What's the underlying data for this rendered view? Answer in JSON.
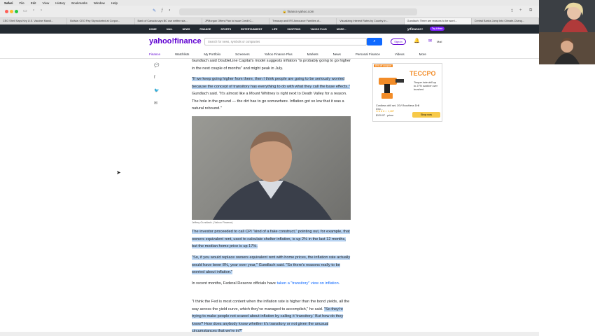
{
  "menubar": {
    "items": [
      "Safari",
      "File",
      "Edit",
      "View",
      "History",
      "Bookmarks",
      "Window",
      "Help"
    ]
  },
  "browser": {
    "url": "finance.yahoo.com",
    "tabs": [
      "CEO Shell Says Key U.S. Vaccine Mandl...",
      "Bolivia: CEO Pay Skyrocketed at Corpor...",
      "Bank of Canada says BC use written sta...",
      "JPMorgan Offers Plan to issue Credit C...",
      "Treasury and IRS Announce Families of...",
      "Visualizing Interest Rates by Country in...",
      "Gundlach: There are reasons to be worri...",
      "Central Banks Jump Into Climate-Chang..."
    ]
  },
  "ynav": {
    "items": [
      "HOME",
      "MAIL",
      "NEWS",
      "FINANCE",
      "SPORTS",
      "ENTERTAINMENT",
      "LIFE",
      "SHOPPING",
      "YAHOO PLUS",
      "MORE..."
    ],
    "brand": "y!finance+",
    "try_free": "Try it free"
  },
  "header": {
    "logo": "yahoo!finance",
    "search_placeholder": "Search for news, symbols or companies",
    "sign_in": "Sign in",
    "mail": "Mail"
  },
  "subnav": {
    "items": [
      "Finance",
      "Watchlists",
      "My Portfolio",
      "Screeners",
      "Yahoo Finance Plus",
      "Markets",
      "News",
      "Personal Finance",
      "Videos",
      "More"
    ]
  },
  "article": {
    "p1": "Gundlach said DoubleLine Capital's model suggests inflation \"is probably going to go higher in the next couple of months\" and might peak in July.",
    "p2_hl": "\"If we keep going higher from there, then I think people are going to be seriously worried because the concept of transitory has everything to do with what they call the base effects,\"",
    "p2_rest": " Gundlach said. \"It's almost like a Mount Whitney is right next to Death Valley for a reason. The hole in the ground — the dirt has to go somewhere. Inflation got so low that it was a natural rebound.\"",
    "caption": "Jeffrey Gundlach. (Yahoo Finance)",
    "p3": "The investor proceeded to call CPI \"kind of a fake construct,\" pointing out, for example, that owners equivalent rent, used to calculate shelter inflation, is up 2% in the last 12 months, but the median home price is up 17%.",
    "p4": "\"So, if you would replace owners equivalent rent with home prices, the inflation rate actually would have been 8%, year over year,\" Gundlach said. \"So there's reasons really to be worried about inflation.\"",
    "p5_pre": "In recent months, Federal Reserve officials have ",
    "p5_link": "taken a \"transitory\" view on inflation",
    "p5_post": ".",
    "p6_pre": "\"I think the Fed is most content when the inflation rate is higher than the bond yields, all the way across the yield curve, which they've managed to accomplish,\" he said. ",
    "p6_hl": "\"So they're trying to make people not scared about inflation by calling it 'transitory.' But how do they know? How does anybody know whether it's transitory or not given the unusual circumstances that we're in?\""
  },
  "ad": {
    "badge": "8% off coupon",
    "brand": "TECCPO",
    "tagline": "Torque hole drill up to 37% runtime over brushed.",
    "desc": "Cordless drill set, 20V Brushless Drill Driv...",
    "rating": "★★★★☆ 1,467",
    "price": "$129.97 · prime",
    "button": "Shop now"
  }
}
